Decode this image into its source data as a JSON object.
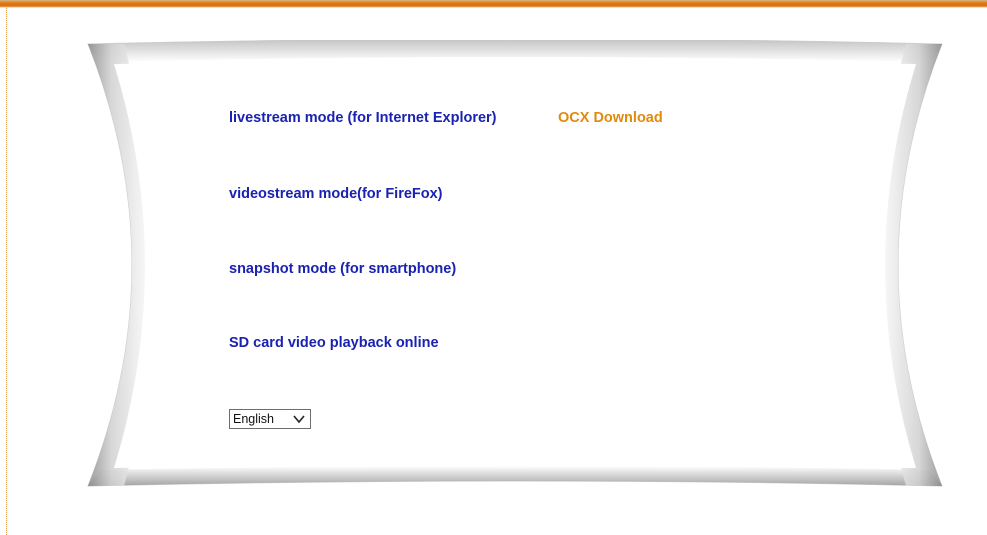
{
  "links": {
    "livestream": "livestream mode (for Internet Explorer)",
    "ocx_download": "OCX Download",
    "videostream": "videostream mode(for FireFox)",
    "snapshot": "snapshot mode (for smartphone)",
    "sd_playback": "SD card video playback online"
  },
  "language_select": {
    "selected": "English",
    "icon": "chevron-down-icon"
  },
  "colors": {
    "link_blue": "#1a22b0",
    "link_orange": "#e08a0e",
    "top_bar": "#e07a12"
  }
}
